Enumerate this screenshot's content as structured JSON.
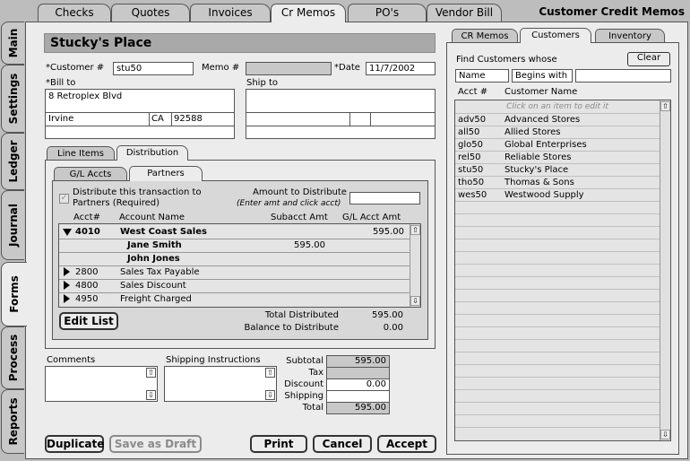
{
  "app_title": "Customer Credit Memos",
  "top_tabs": [
    "Checks",
    "Quotes",
    "Invoices",
    "Cr Memos",
    "PO's",
    "Vendor Bill"
  ],
  "left_tabs": [
    "Main",
    "Settings",
    "Ledger",
    "Journal",
    "Forms",
    "Process",
    "Reports"
  ],
  "header": {
    "customer_title": "Stucky's Place"
  },
  "form": {
    "customer_label": "*Customer #",
    "customer_value": "stu50",
    "memo_label": "Memo #",
    "memo_value": "",
    "date_label": "*Date",
    "date_value": "11/7/2002",
    "bill_to_label": "*Bill to",
    "ship_to_label": "Ship to",
    "bill_address": "8 Retroplex Blvd",
    "bill_city": "Irvine",
    "bill_state": "CA",
    "bill_zip": "92588"
  },
  "detail_tabs": [
    "Line Items",
    "Distribution"
  ],
  "dist_tabs": [
    "G/L Accts",
    "Partners"
  ],
  "distribution": {
    "checkbox_label_1": "Distribute this transaction to",
    "checkbox_label_2": "Partners (Required)",
    "amount_label": "Amount to Distribute",
    "amount_hint": "(Enter amt and click acct)",
    "amount_value": "",
    "col_acct": "Acct#",
    "col_name": "Account Name",
    "col_subacct": "Subacct Amt",
    "col_glamt": "G/L Acct Amt",
    "rows": [
      {
        "acct": "4010",
        "name": "West Coast Sales",
        "subamt": "",
        "glamt": "595.00"
      },
      {
        "acct": "",
        "name": "Jane Smith",
        "subamt": "595.00",
        "glamt": ""
      },
      {
        "acct": "",
        "name": "John Jones",
        "subamt": "",
        "glamt": ""
      },
      {
        "acct": "2800",
        "name": "Sales Tax Payable",
        "subamt": "",
        "glamt": ""
      },
      {
        "acct": "4800",
        "name": "Sales Discount",
        "subamt": "",
        "glamt": ""
      },
      {
        "acct": "4950",
        "name": "Freight Charged",
        "subamt": "",
        "glamt": ""
      }
    ],
    "edit_list_label": "Edit List",
    "total_distributed_label": "Total Distributed",
    "total_distributed_value": "595.00",
    "balance_label": "Balance to Distribute",
    "balance_value": "0.00"
  },
  "notes": {
    "comments_label": "Comments",
    "shipping_label": "Shipping Instructions"
  },
  "totals": {
    "subtotal_label": "Subtotal",
    "subtotal_value": "595.00",
    "tax_label": "Tax",
    "tax_value": "",
    "discount_label": "Discount",
    "discount_value": "0.00",
    "shipping_label": "Shipping",
    "shipping_value": "",
    "total_label": "Total",
    "total_value": "595.00"
  },
  "buttons": {
    "duplicate": "Duplicate",
    "save_draft": "Save as Draft",
    "print": "Print",
    "cancel": "Cancel",
    "accept": "Accept"
  },
  "right_tabs": [
    "CR Memos",
    "Customers",
    "Inventory"
  ],
  "finder": {
    "label": "Find Customers whose",
    "clear_label": "Clear",
    "field_value": "Name",
    "op_value": "Begins with",
    "search_value": "",
    "col_acct": "Acct #",
    "col_name": "Customer Name",
    "hint": "Click on an item to edit it",
    "customers": [
      {
        "acct": "adv50",
        "name": "Advanced Stores"
      },
      {
        "acct": "all50",
        "name": "Allied Stores"
      },
      {
        "acct": "glo50",
        "name": "Global Enterprises"
      },
      {
        "acct": "rel50",
        "name": "Reliable Stores"
      },
      {
        "acct": "stu50",
        "name": "Stucky's Place"
      },
      {
        "acct": "tho50",
        "name": "Thomas & Sons"
      },
      {
        "acct": "wes50",
        "name": "Westwood Supply"
      }
    ]
  },
  "icons": {
    "scroll_up": "scroll-up-arrow-icon",
    "scroll_down": "scroll-down-arrow-icon",
    "expand": "disclosure-triangle-icon",
    "check": "checkmark-icon"
  }
}
